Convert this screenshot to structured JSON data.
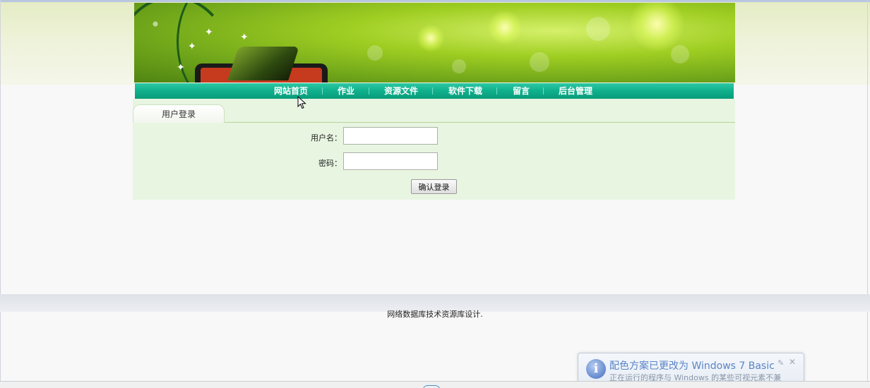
{
  "nav": {
    "items": [
      {
        "label": "网站首页"
      },
      {
        "label": "作业"
      },
      {
        "label": "资源文件"
      },
      {
        "label": "软件下载"
      },
      {
        "label": "留言"
      },
      {
        "label": "后台管理"
      }
    ]
  },
  "login": {
    "tab_label": "用户登录",
    "username_label": "用户名：",
    "username_value": "",
    "password_label": "密码：",
    "password_value": "",
    "submit_label": "确认登录"
  },
  "footer": {
    "text": "网络数据库技术资源库设计."
  },
  "notification": {
    "title": "配色方案已更改为 Windows 7 Basic",
    "body": "正在运行的程序与 Windows 的某些可视元素不兼容。请单击此处获取详细信息。"
  },
  "colors": {
    "nav_bg": "#10b08c",
    "panel_bg": "#e8f5e1",
    "banner_green": "#9fce22",
    "notify_title": "#5a84c6"
  }
}
